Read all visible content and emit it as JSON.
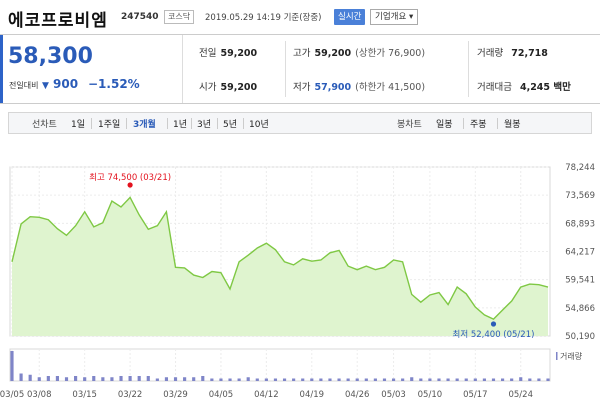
{
  "header": {
    "company_name": "에코프로비엠",
    "code": "247540",
    "market": "코스닥",
    "timestamp": "2019.05.29 14:19  기준(장중)",
    "realtime_label": "실시간",
    "company_info_label": "기업개요 ▾"
  },
  "price": {
    "current": "58,300",
    "change_label": "전일대비",
    "change_value": "900",
    "change_pct": "−1.52%",
    "direction": "down",
    "color": "#2a5bb8"
  },
  "stats": {
    "prev_close_label": "전일",
    "prev_close": "59,200",
    "open_label": "시가",
    "open": "59,200",
    "high_label": "고가",
    "high": "59,200",
    "upper_limit": "(상한가 76,900)",
    "low_label": "저가",
    "low": "57,900",
    "lower_limit": "(하한가 41,500)",
    "volume_label": "거래량",
    "volume": "72,718",
    "amount_label": "거래대금",
    "amount": "4,245 백만"
  },
  "periods": {
    "line_label": "선차트",
    "line_options": [
      "1일",
      "1주일",
      "3개월",
      "1년",
      "3년",
      "5년",
      "10년"
    ],
    "active": "3개월",
    "candle_label": "봉차트",
    "candle_options": [
      "일봉",
      "주봉",
      "월봉"
    ]
  },
  "chart_data": {
    "type": "area",
    "dates": [
      "03/05",
      "03/06",
      "03/07",
      "03/08",
      "03/11",
      "03/12",
      "03/13",
      "03/14",
      "03/15",
      "03/18",
      "03/19",
      "03/20",
      "03/21",
      "03/22",
      "03/25",
      "03/26",
      "03/27",
      "03/28",
      "03/29",
      "04/01",
      "04/02",
      "04/03",
      "04/04",
      "04/05",
      "04/08",
      "04/09",
      "04/10",
      "04/11",
      "04/12",
      "04/15",
      "04/16",
      "04/17",
      "04/18",
      "04/19",
      "04/22",
      "04/23",
      "04/24",
      "04/25",
      "04/26",
      "04/29",
      "04/30",
      "05/02",
      "05/03",
      "05/07",
      "05/08",
      "05/09",
      "05/10",
      "05/13",
      "05/14",
      "05/15",
      "05/16",
      "05/17",
      "05/20",
      "05/21",
      "05/22",
      "05/23",
      "05/24",
      "05/27",
      "05/28",
      "05/29"
    ],
    "values": [
      62500,
      68800,
      70000,
      69900,
      69500,
      68000,
      66900,
      68500,
      70800,
      68300,
      69000,
      72600,
      71600,
      73200,
      70300,
      67900,
      68500,
      70800,
      61600,
      61500,
      60300,
      59900,
      60900,
      60700,
      58000,
      62500,
      63600,
      64800,
      65600,
      64500,
      62500,
      62000,
      63000,
      62600,
      62800,
      64000,
      64400,
      61800,
      61200,
      61800,
      61200,
      61600,
      62800,
      62500,
      57100,
      55800,
      57000,
      57400,
      55400,
      58300,
      57200,
      55000,
      53700,
      53000,
      54500,
      56000,
      58300,
      58800,
      58700,
      58300
    ],
    "yticks": [
      78244,
      73569,
      68893,
      64217,
      59541,
      54866,
      50190
    ],
    "ylim": [
      50190,
      78244
    ],
    "xticks": [
      "03/05",
      "03/08",
      "03/15",
      "03/22",
      "03/29",
      "04/05",
      "04/12",
      "04/19",
      "04/26",
      "05/03",
      "05/10",
      "05/17",
      "05/24"
    ],
    "high_label": "최고",
    "high_text": "74,500 (03/21)",
    "high_color": "#e3121e",
    "low_label": "최저",
    "low_text": "52,400 (05/21)",
    "low_color": "#2a5bb8",
    "volume_label": "거래량",
    "volume": [
      24,
      6,
      5,
      3,
      4,
      4,
      3,
      4,
      3,
      4,
      3,
      3,
      4,
      4,
      4,
      4,
      2,
      3,
      3,
      3,
      3,
      4,
      2,
      2,
      2,
      2,
      3,
      2,
      2,
      2,
      2,
      2,
      2,
      2,
      2,
      2,
      2,
      2,
      2,
      2,
      2,
      2,
      2,
      2,
      3,
      2,
      2,
      2,
      2,
      2,
      2,
      2,
      2,
      2,
      2,
      2,
      3,
      2,
      2,
      2
    ],
    "line_color": "#7fc844",
    "fill_color": "#dff4cf",
    "volume_color": "#7f85c8"
  }
}
